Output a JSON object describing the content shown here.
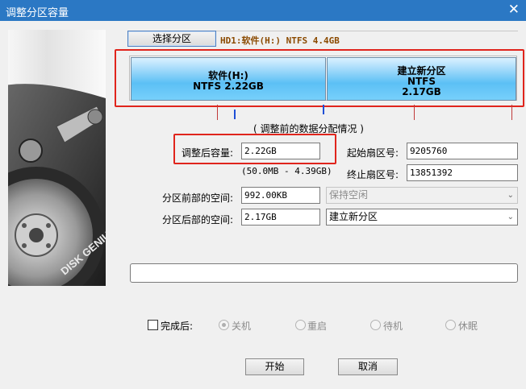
{
  "window": {
    "title": "调整分区容量",
    "close_glyph": "✕"
  },
  "header": {
    "select_partition_label": "选择分区",
    "disk_info": "HD1:软件(H:) NTFS 4.4GB"
  },
  "partitions": [
    {
      "lines": [
        "软件(H:)",
        "NTFS 2.22GB"
      ],
      "color": "#5cc0f5"
    },
    {
      "lines": [
        "建立新分区",
        "NTFS",
        "2.17GB"
      ],
      "color": "#5cc0f5"
    }
  ],
  "subtitle": "( 调整前的数据分配情况 )",
  "form": {
    "size_after_label": "调整后容量:",
    "size_after_value": "2.22GB",
    "size_range": "(50.0MB - 4.39GB)",
    "start_sector_label": "起始扇区号:",
    "start_sector_value": "9205760",
    "end_sector_label": "终止扇区号:",
    "end_sector_value": "13851392",
    "space_before_label": "分区前部的空间:",
    "space_before_value": "992.00KB",
    "space_before_option": "保持空闲",
    "space_after_label": "分区后部的空间:",
    "space_after_value": "2.17GB",
    "space_after_option": "建立新分区"
  },
  "after_completion": {
    "label": "完成后:",
    "options": [
      "关机",
      "重启",
      "待机",
      "休眠"
    ],
    "selected": "关机",
    "checked": false
  },
  "buttons": {
    "start": "开始",
    "cancel": "取消"
  },
  "brand_text": "DISK GENIUS",
  "colors": {
    "titlebar": "#2b78c4",
    "highlight_box": "#e0241c",
    "partition_fill": "#5cc0f5",
    "disk_info_text": "#8b4a00"
  }
}
